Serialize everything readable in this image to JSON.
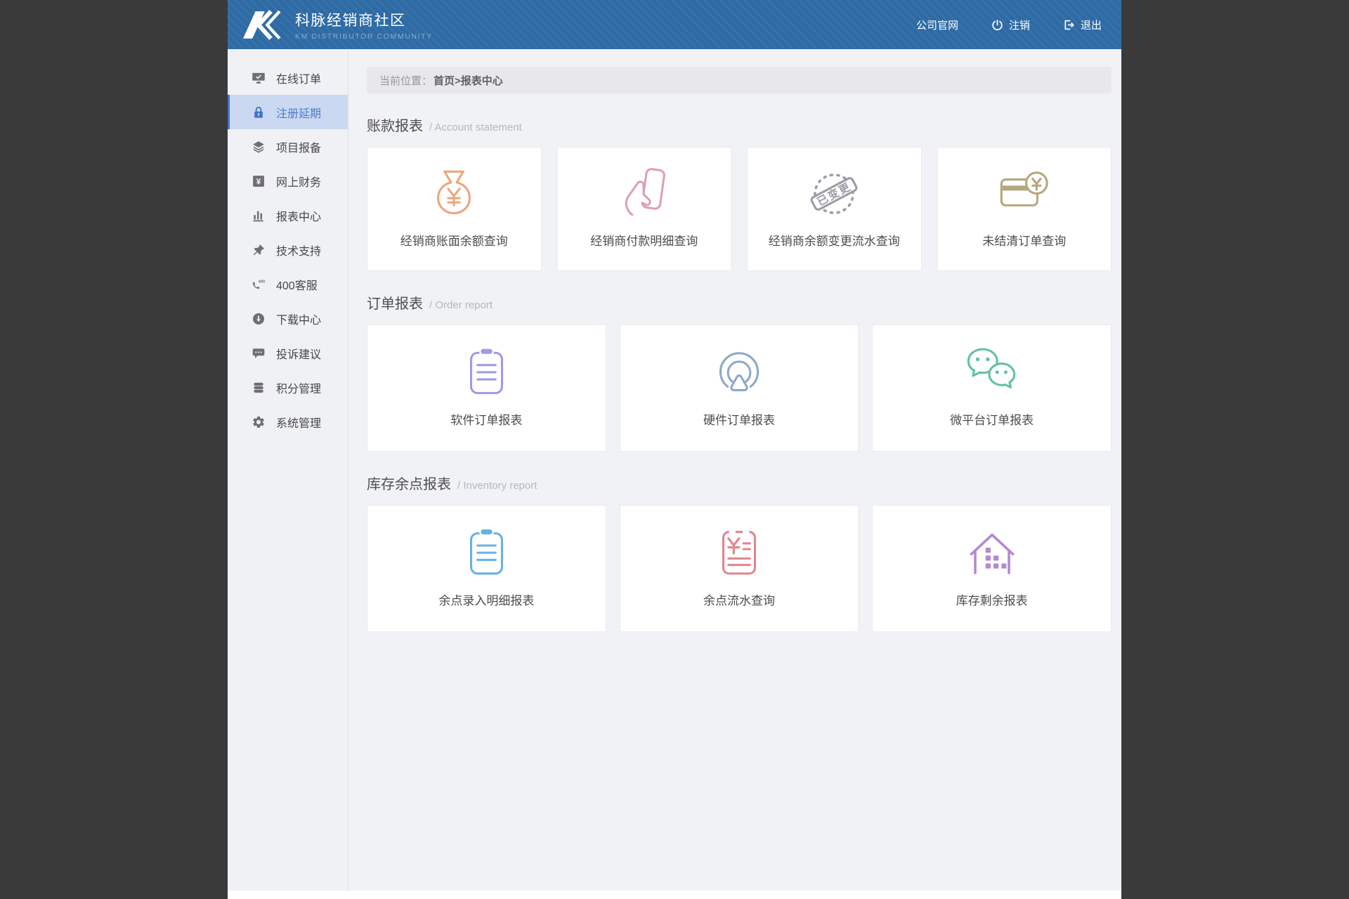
{
  "header": {
    "logo_title": "科脉经销商社区",
    "logo_subtitle": "KM DISTRIBUTOR COMMUNITY",
    "links": [
      {
        "label": "公司官网",
        "icon": "none"
      },
      {
        "label": "注销",
        "icon": "power-icon"
      },
      {
        "label": "退出",
        "icon": "logout-icon"
      }
    ]
  },
  "sidebar": {
    "items": [
      {
        "label": "在线订单",
        "icon": "monitor-check-icon",
        "active": false
      },
      {
        "label": "注册延期",
        "icon": "lock-icon",
        "active": true
      },
      {
        "label": "项目报备",
        "icon": "layers-icon",
        "active": false
      },
      {
        "label": "网上财务",
        "icon": "yuan-square-icon",
        "active": false
      },
      {
        "label": "报表中心",
        "icon": "bar-chart-icon",
        "active": false
      },
      {
        "label": "技术支持",
        "icon": "pushpin-icon",
        "active": false
      },
      {
        "label": "400客服",
        "icon": "phone-400-icon",
        "active": false
      },
      {
        "label": "下载中心",
        "icon": "download-icon",
        "active": false
      },
      {
        "label": "投诉建议",
        "icon": "feedback-icon",
        "active": false
      },
      {
        "label": "积分管理",
        "icon": "coins-icon",
        "active": false
      },
      {
        "label": "系统管理",
        "icon": "gear-icon",
        "active": false
      }
    ]
  },
  "breadcrumb": {
    "prefix": "当前位置：",
    "path": "首页>报表中心"
  },
  "sections": [
    {
      "title_zh": "账款报表",
      "title_en": "/ Account statement",
      "cards": [
        {
          "label": "经销商账面余额查询",
          "icon": "money-bag-icon",
          "color": "#eaa77c"
        },
        {
          "label": "经销商付款明细查询",
          "icon": "hand-card-icon",
          "color": "#dc9fb6"
        },
        {
          "label": "经销商余额变更流水查询",
          "icon": "changed-stamp-icon",
          "color": "#9b9ca6",
          "stamp_text": "已变更"
        },
        {
          "label": "未结清订单查询",
          "icon": "card-coin-icon",
          "color": "#b5a77d"
        }
      ]
    },
    {
      "title_zh": "订单报表",
      "title_en": "/ Order report",
      "cards": [
        {
          "label": "软件订单报表",
          "icon": "clipboard-icon",
          "color": "#9e99e8"
        },
        {
          "label": "硬件订单报表",
          "icon": "radar-click-icon",
          "color": "#8ea8c8"
        },
        {
          "label": "微平台订单报表",
          "icon": "wechat-icon",
          "color": "#5ec49e"
        }
      ]
    },
    {
      "title_zh": "库存余点报表",
      "title_en": "/ Inventory report",
      "cards": [
        {
          "label": "余点录入明细报表",
          "icon": "clipboard-icon",
          "color": "#66b1e4"
        },
        {
          "label": "余点流水查询",
          "icon": "yuan-doc-icon",
          "color": "#e2858e"
        },
        {
          "label": "库存剩余报表",
          "icon": "warehouse-icon",
          "color": "#b588cf"
        }
      ]
    }
  ],
  "colors": {
    "header_bg": "#2e6ba5",
    "active_item_bg": "#cbd8f1",
    "active_item_accent": "#3f73c6",
    "content_bg": "#f1f2f5",
    "outer_bg": "#3a3a3b"
  }
}
